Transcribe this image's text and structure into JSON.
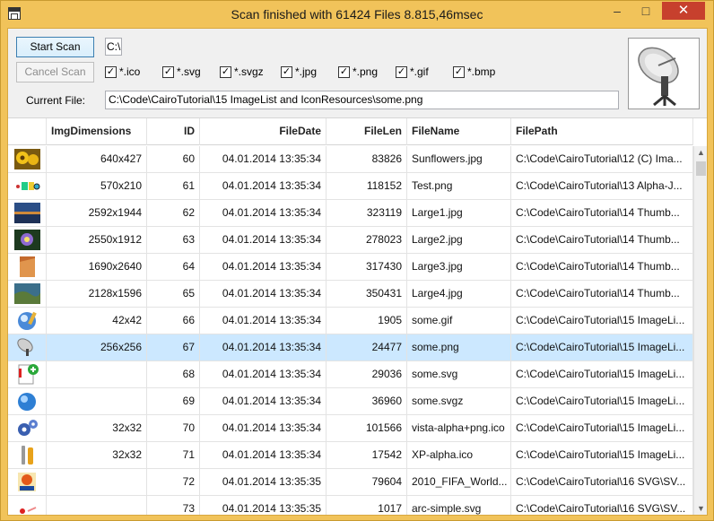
{
  "window": {
    "title": "Scan finished with 61424 Files 8.815,46msec",
    "minimize": "–",
    "maximize": "□",
    "close": "✕"
  },
  "toolbar": {
    "start_label": "Start Scan",
    "cancel_label": "Cancel Scan",
    "path_value": "C:\\",
    "current_file_label": "Current File:",
    "current_file_value": "C:\\Code\\CairoTutorial\\15 ImageList and IconResources\\some.png"
  },
  "filters": [
    {
      "label": "*.ico",
      "checked": true
    },
    {
      "label": "*.svg",
      "checked": true
    },
    {
      "label": "*.svgz",
      "checked": true
    },
    {
      "label": "*.jpg",
      "checked": true
    },
    {
      "label": "*.png",
      "checked": true
    },
    {
      "label": "*.gif",
      "checked": true
    },
    {
      "label": "*.bmp",
      "checked": true
    }
  ],
  "check_glyph": "✓",
  "columns": [
    "",
    "ImgDimensions",
    "ID",
    "FileDate",
    "FileLen",
    "FileName",
    "FilePath"
  ],
  "rows": [
    {
      "thumb": "sunflowers",
      "dim": "640x427",
      "id": "60",
      "date": "04.01.2014 13:35:34",
      "len": "83826",
      "name": "Sunflowers.jpg",
      "path": "C:\\Code\\CairoTutorial\\12 (C) Ima..."
    },
    {
      "thumb": "test-strip",
      "dim": "570x210",
      "id": "61",
      "date": "04.01.2014 13:35:34",
      "len": "118152",
      "name": "Test.png",
      "path": "C:\\Code\\CairoTutorial\\13 Alpha-J..."
    },
    {
      "thumb": "landscape-sea",
      "dim": "2592x1944",
      "id": "62",
      "date": "04.01.2014 13:35:34",
      "len": "323119",
      "name": "Large1.jpg",
      "path": "C:\\Code\\CairoTutorial\\14 Thumb..."
    },
    {
      "thumb": "flower-purple",
      "dim": "2550x1912",
      "id": "63",
      "date": "04.01.2014 13:35:34",
      "len": "278023",
      "name": "Large2.jpg",
      "path": "C:\\Code\\CairoTutorial\\14 Thumb..."
    },
    {
      "thumb": "desert",
      "dim": "1690x2640",
      "id": "64",
      "date": "04.01.2014 13:35:34",
      "len": "317430",
      "name": "Large3.jpg",
      "path": "C:\\Code\\CairoTutorial\\14 Thumb..."
    },
    {
      "thumb": "coast",
      "dim": "2128x1596",
      "id": "65",
      "date": "04.01.2014 13:35:34",
      "len": "350431",
      "name": "Large4.jpg",
      "path": "C:\\Code\\CairoTutorial\\14 Thumb..."
    },
    {
      "thumb": "globe-pen",
      "dim": "42x42",
      "id": "66",
      "date": "04.01.2014 13:35:34",
      "len": "1905",
      "name": "some.gif",
      "path": "C:\\Code\\CairoTutorial\\15 ImageLi..."
    },
    {
      "thumb": "satellite-dish",
      "dim": "256x256",
      "id": "67",
      "date": "04.01.2014 13:35:34",
      "len": "24477",
      "name": "some.png",
      "path": "C:\\Code\\CairoTutorial\\15 ImageLi...",
      "selected": true
    },
    {
      "thumb": "doc-add",
      "dim": "",
      "id": "68",
      "date": "04.01.2014 13:35:34",
      "len": "29036",
      "name": "some.svg",
      "path": "C:\\Code\\CairoTutorial\\15 ImageLi..."
    },
    {
      "thumb": "blue-globe",
      "dim": "",
      "id": "69",
      "date": "04.01.2014 13:35:34",
      "len": "36960",
      "name": "some.svgz",
      "path": "C:\\Code\\CairoTutorial\\15 ImageLi..."
    },
    {
      "thumb": "gears",
      "dim": "32x32",
      "id": "70",
      "date": "04.01.2014 13:35:34",
      "len": "101566",
      "name": "vista-alpha+png.ico",
      "path": "C:\\Code\\CairoTutorial\\15 ImageLi..."
    },
    {
      "thumb": "tools",
      "dim": "32x32",
      "id": "71",
      "date": "04.01.2014 13:35:34",
      "len": "17542",
      "name": "XP-alpha.ico",
      "path": "C:\\Code\\CairoTutorial\\15 ImageLi..."
    },
    {
      "thumb": "fifa-logo",
      "dim": "",
      "id": "72",
      "date": "04.01.2014 13:35:35",
      "len": "79604",
      "name": "2010_FIFA_World...",
      "path": "C:\\Code\\CairoTutorial\\16 SVG\\SV..."
    },
    {
      "thumb": "arc-simple",
      "dim": "",
      "id": "73",
      "date": "04.01.2014 13:35:35",
      "len": "1017",
      "name": "arc-simple.svg",
      "path": "C:\\Code\\CairoTutorial\\16 SVG\\SV..."
    }
  ],
  "scroll": {
    "up": "▲",
    "down": "▼"
  }
}
